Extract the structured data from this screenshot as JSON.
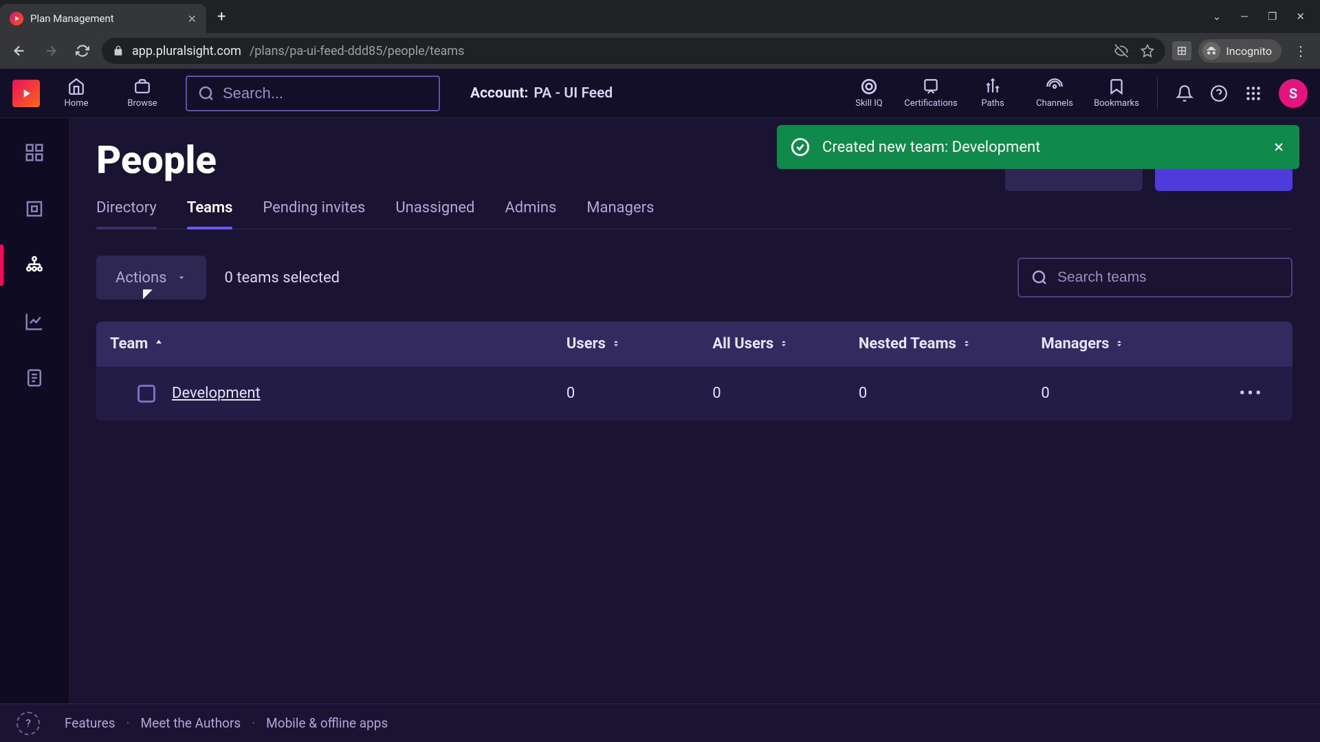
{
  "browser": {
    "tab_title": "Plan Management",
    "incognito_label": "Incognito",
    "url_host": "app.pluralsight.com",
    "url_path": "/plans/pa-ui-feed-ddd85/people/teams"
  },
  "header": {
    "nav": {
      "home": "Home",
      "browse": "Browse"
    },
    "search_placeholder": "Search...",
    "account_label": "Account:",
    "account_value": "PA - UI Feed",
    "items": {
      "skilliq": "Skill IQ",
      "certifications": "Certifications",
      "paths": "Paths",
      "channels": "Channels",
      "bookmarks": "Bookmarks"
    },
    "avatar_initial": "S"
  },
  "toast": {
    "message": "Created new team: Development"
  },
  "page": {
    "title": "People",
    "tabs": [
      "Directory",
      "Teams",
      "Pending invites",
      "Unassigned",
      "Admins",
      "Managers"
    ],
    "active_tab_index": 1,
    "actions_label": "Actions",
    "selection_text": "0 teams selected",
    "team_search_placeholder": "Search teams"
  },
  "table": {
    "columns": [
      "Team",
      "Users",
      "All Users",
      "Nested Teams",
      "Managers"
    ],
    "rows": [
      {
        "team": "Development",
        "users": "0",
        "all_users": "0",
        "nested_teams": "0",
        "managers": "0"
      }
    ]
  },
  "footer": {
    "links": [
      "Features",
      "Meet the Authors",
      "Mobile & offline apps"
    ]
  }
}
